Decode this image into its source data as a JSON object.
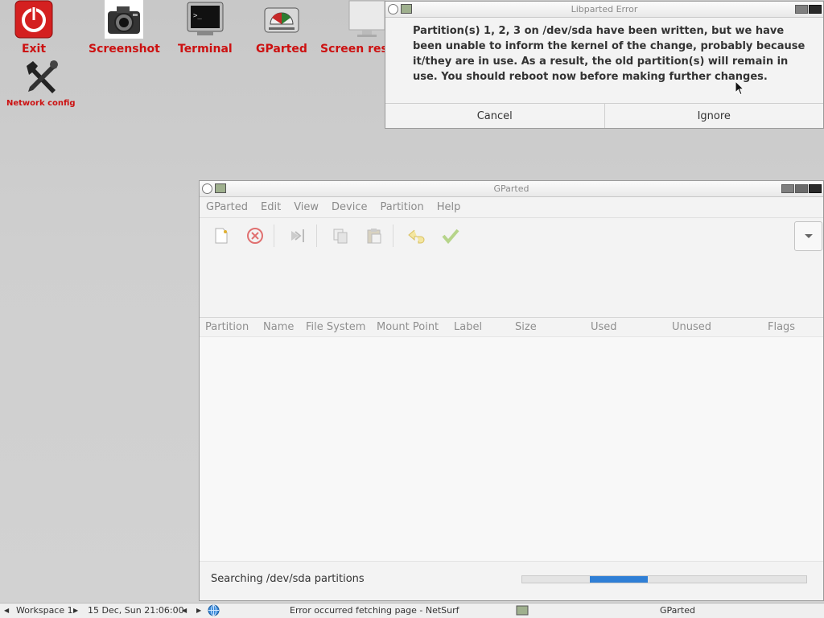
{
  "desktop": {
    "icons": [
      {
        "label": "Exit"
      },
      {
        "label": "Screenshot"
      },
      {
        "label": "Terminal"
      },
      {
        "label": "GParted"
      },
      {
        "label": "Screen resol"
      },
      {
        "label": "Network config"
      }
    ]
  },
  "error_dialog": {
    "title": "Libparted Error",
    "message": "Partition(s) 1, 2, 3 on /dev/sda have been written, but we have been unable to inform the kernel of the change, probably because it/they are in use.  As a result, the old partition(s) will remain in use.  You should reboot now before making further changes.",
    "cancel_label": "Cancel",
    "ignore_label": "Ignore"
  },
  "gparted": {
    "title": "GParted",
    "menu": [
      "GParted",
      "Edit",
      "View",
      "Device",
      "Partition",
      "Help"
    ],
    "columns": [
      "Partition",
      "Name",
      "File System",
      "Mount Point",
      "Label",
      "Size",
      "Used",
      "Unused",
      "Flags"
    ],
    "status_text": "Searching /dev/sda partitions",
    "progress_color": "#2f7fd6"
  },
  "taskbar": {
    "workspace": "Workspace 1",
    "clock": "15 Dec, Sun 21:06:00",
    "task1": "Error occurred fetching page - NetSurf",
    "task2": "GParted"
  }
}
